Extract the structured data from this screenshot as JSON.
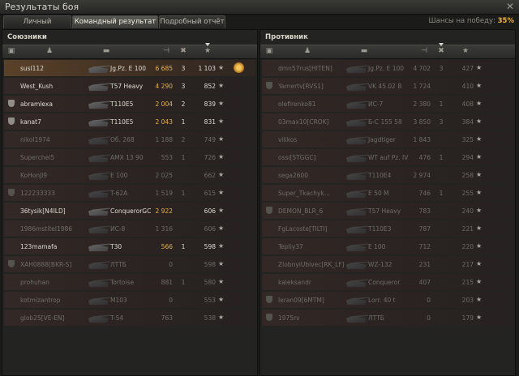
{
  "window": {
    "title": "Результаты боя"
  },
  "tabs": [
    {
      "label": "Личный результат"
    },
    {
      "label": "Командный результат"
    },
    {
      "label": "Подробный отчёт"
    }
  ],
  "chances": {
    "label": "Шансы на победу:",
    "value": "35%"
  },
  "allies": {
    "title": "Союзники",
    "rows": [
      {
        "name": "susl112",
        "vehicle": "Jg.Pz. E 100",
        "damage": "6 685",
        "frags": "3",
        "xp": "1 103",
        "alive": true,
        "clan": false,
        "player": true,
        "medal": true
      },
      {
        "name": "West_Kush",
        "vehicle": "T57 Heavy",
        "damage": "4 290",
        "frags": "3",
        "xp": "852",
        "alive": true,
        "clan": false
      },
      {
        "name": "abramlexa",
        "vehicle": "T110E5",
        "damage": "2 004",
        "frags": "2",
        "xp": "839",
        "alive": true,
        "clan": true
      },
      {
        "name": "kanat7",
        "vehicle": "T110E5",
        "damage": "2 043",
        "frags": "1",
        "xp": "831",
        "alive": true,
        "clan": true
      },
      {
        "name": "nikol1974",
        "vehicle": "Об. 268",
        "damage": "1 188",
        "frags": "2",
        "xp": "749",
        "alive": false,
        "clan": false
      },
      {
        "name": "Superchel5",
        "vehicle": "AMX 13 90",
        "damage": "553",
        "frags": "1",
        "xp": "726",
        "alive": false,
        "clan": false
      },
      {
        "name": "KoHonJl9",
        "vehicle": "E 100",
        "damage": "2 025",
        "frags": "",
        "xp": "662",
        "alive": false,
        "clan": false
      },
      {
        "name": "122233333",
        "vehicle": "T-62A",
        "damage": "1 519",
        "frags": "1",
        "xp": "615",
        "alive": false,
        "clan": true
      },
      {
        "name": "36tysik[N4ILD]",
        "vehicle": "ConquerorGC",
        "damage": "2 922",
        "frags": "",
        "xp": "606",
        "alive": true,
        "clan": false
      },
      {
        "name": "1986mstitel1986",
        "vehicle": "ИС-8",
        "damage": "1 316",
        "frags": "",
        "xp": "606",
        "alive": false,
        "clan": false
      },
      {
        "name": "123mamafa",
        "vehicle": "T30",
        "damage": "566",
        "frags": "1",
        "xp": "598",
        "alive": true,
        "clan": false
      },
      {
        "name": "XAH0888[BKR-S]",
        "vehicle": "ЛТТБ",
        "damage": "0",
        "frags": "",
        "xp": "598",
        "alive": false,
        "clan": true
      },
      {
        "name": "prohuhan",
        "vehicle": "Tortoise",
        "damage": "881",
        "frags": "1",
        "xp": "580",
        "alive": false,
        "clan": false
      },
      {
        "name": "kotmizantrop",
        "vehicle": "M103",
        "damage": "0",
        "frags": "",
        "xp": "553",
        "alive": false,
        "clan": false
      },
      {
        "name": "glob25[VE-EN]",
        "vehicle": "T-54",
        "damage": "763",
        "frags": "",
        "xp": "538",
        "alive": false,
        "clan": false
      }
    ]
  },
  "enemies": {
    "title": "Противник",
    "rows": [
      {
        "name": "dmn57rus[HITEN]",
        "vehicle": "Jg.Pz. E 100",
        "damage": "4 702",
        "frags": "3",
        "xp": "427",
        "alive": false,
        "clan": false
      },
      {
        "name": "Yamertv[RVS1]",
        "vehicle": "VK 45.02 B",
        "damage": "1 724",
        "frags": "",
        "xp": "410",
        "alive": false,
        "clan": true
      },
      {
        "name": "olefirenko81",
        "vehicle": "ИС-7",
        "damage": "2 380",
        "frags": "1",
        "xp": "408",
        "alive": false,
        "clan": false
      },
      {
        "name": "03max10[CROK]",
        "vehicle": "Б-С 155 58",
        "damage": "3 850",
        "frags": "3",
        "xp": "384",
        "alive": false,
        "clan": false
      },
      {
        "name": "vilikos",
        "vehicle": "Jagdtiger",
        "damage": "1 843",
        "frags": "",
        "xp": "325",
        "alive": false,
        "clan": false
      },
      {
        "name": "ossi[STGGC]",
        "vehicle": "WT auf Pz. IV",
        "damage": "476",
        "frags": "1",
        "xp": "294",
        "alive": false,
        "clan": false
      },
      {
        "name": "sega2600",
        "vehicle": "T110E4",
        "damage": "2 974",
        "frags": "",
        "xp": "258",
        "alive": false,
        "clan": false
      },
      {
        "name": "Super_Tkachyk...",
        "vehicle": "E 50 M",
        "damage": "746",
        "frags": "1",
        "xp": "255",
        "alive": false,
        "clan": false
      },
      {
        "name": "DEMON_BLR_6",
        "vehicle": "T57 Heavy",
        "damage": "783",
        "frags": "",
        "xp": "240",
        "alive": false,
        "clan": true
      },
      {
        "name": "FgLacoste[TILTI]",
        "vehicle": "T110E3",
        "damage": "787",
        "frags": "",
        "xp": "221",
        "alive": false,
        "clan": false
      },
      {
        "name": "Tepliy37",
        "vehicle": "E 100",
        "damage": "712",
        "frags": "",
        "xp": "220",
        "alive": false,
        "clan": false
      },
      {
        "name": "ZlobnyiUbivec[RK_LF]",
        "vehicle": "WZ-132",
        "damage": "231",
        "frags": "",
        "xp": "217",
        "alive": false,
        "clan": false
      },
      {
        "name": "kaleksandr",
        "vehicle": "Conqueror",
        "damage": "407",
        "frags": "",
        "xp": "215",
        "alive": false,
        "clan": false
      },
      {
        "name": "leran09[6MTM]",
        "vehicle": "Lorr. 40 t",
        "damage": "0",
        "frags": "",
        "xp": "203",
        "alive": false,
        "clan": true
      },
      {
        "name": "1975rv",
        "vehicle": "ЛТТБ",
        "damage": "0",
        "frags": "",
        "xp": "179",
        "alive": false,
        "clan": true
      }
    ]
  },
  "column_icons": [
    "squad-icon",
    "player-icon",
    "tank-icon",
    "damage-icon",
    "frags-icon",
    "xp-star-icon"
  ],
  "colors": {
    "accent": "#f0b23a",
    "damage_alive": "#e5b24a",
    "dead_text": "#6f6d66",
    "alive_text": "#dedcd2"
  }
}
